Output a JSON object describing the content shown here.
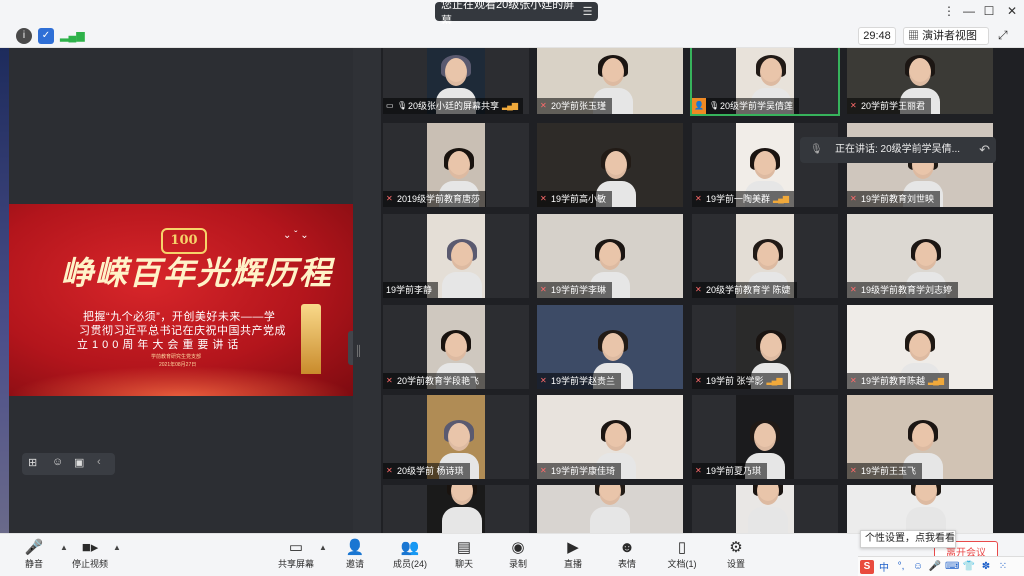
{
  "titlebar": {
    "watching": "您正在观看20级张小廷的屏幕",
    "menu_icon": "hamburger-icon"
  },
  "toolbar": {
    "timer": "29:48",
    "view_mode": "演讲者视图",
    "colors": {
      "info": "#4a4a4a",
      "shield": "#2f6fd6",
      "signal": "#2eb24a"
    }
  },
  "share": {
    "banner_logo": "100",
    "banner_title": "峥嵘百年光辉历程",
    "line1": "把握“九个必须”，开创美好未来——学",
    "line2": "习贯彻习近平总书记在庆祝中国共产党成",
    "line3": "立100周年大会重要讲话",
    "org": "学前教育研究生党支部",
    "date": "2021年08月27日",
    "banner_colors": [
      "#d8262a",
      "#7d0b10"
    ]
  },
  "speaking": {
    "text": "正在讲话: 20级学前学吴倩...",
    "back_icon": "return-icon"
  },
  "participants": [
    {
      "name": "20级张小廷的屏幕共享",
      "video": true,
      "level": true,
      "share": true
    },
    {
      "name": "20学前张玉瑾",
      "video": true,
      "level": false
    },
    {
      "name": "20级学前学吴倩莲",
      "video": true,
      "level": false,
      "speaking": true,
      "host": true
    },
    {
      "name": "20学前学王丽君",
      "video": true,
      "level": false
    },
    {
      "name": "2019级学前教育唐莎",
      "video": true,
      "level": false
    },
    {
      "name": "19学前高小敏",
      "video": true,
      "level": false
    },
    {
      "name": "19学前一陶美群",
      "video": true,
      "level": true
    },
    {
      "name": "19学前教育刘世映",
      "video": true,
      "level": false
    },
    {
      "name": "19学前李静",
      "video": true,
      "level": false,
      "no_icon": true
    },
    {
      "name": "19学前学李琳",
      "video": true,
      "level": false
    },
    {
      "name": "20级学前教育学 陈婕",
      "video": true,
      "level": false
    },
    {
      "name": "19级学前教育学刘志婷",
      "video": true,
      "level": false
    },
    {
      "name": "20学前教育学段艳飞",
      "video": true,
      "level": false
    },
    {
      "name": "19学前学赵贵兰",
      "video": true,
      "level": false
    },
    {
      "name": "19学前 张学影",
      "video": true,
      "level": true
    },
    {
      "name": "19学前教育陈越",
      "video": true,
      "level": true
    },
    {
      "name": "20级学前 杨诗琪",
      "video": true,
      "level": false
    },
    {
      "name": "19学前学康佳琦",
      "video": true,
      "level": false
    },
    {
      "name": "19学前夏乃琪",
      "video": true,
      "level": false
    },
    {
      "name": "19学前王玉飞",
      "video": true,
      "level": false
    },
    {
      "name": "",
      "video": true,
      "level": false
    },
    {
      "name": "",
      "video": true,
      "level": false
    },
    {
      "name": "",
      "video": true,
      "level": false
    },
    {
      "name": "",
      "video": true,
      "level": false
    }
  ],
  "bottombar": {
    "mute": "静音",
    "stop_video": "停止视频",
    "share_screen": "共享屏幕",
    "invite": "邀请",
    "members": "成员(24)",
    "chat": "聊天",
    "record": "录制",
    "live": "直播",
    "reactions": "表情",
    "docs": "文档(1)",
    "settings": "设置",
    "tooltip": "个性设置，点我看看",
    "end_meeting": "离开会议"
  },
  "ime": {
    "logo": "S",
    "lang": "中"
  }
}
